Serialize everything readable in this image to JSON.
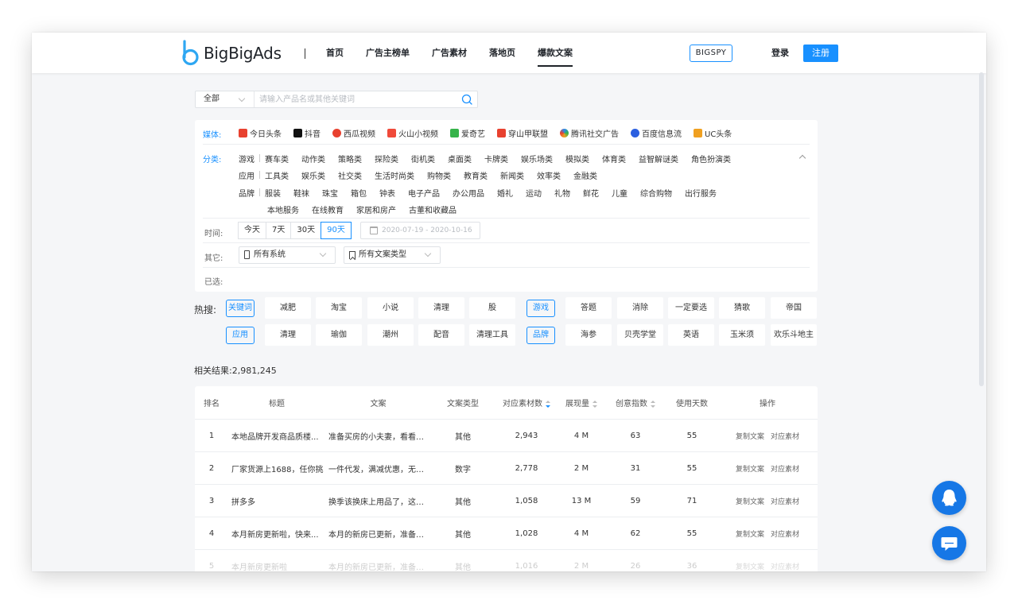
{
  "header": {
    "logo_text": "BigBigAds",
    "nav": [
      "首页",
      "广告主榜单",
      "广告素材",
      "落地页",
      "爆款文案"
    ],
    "active_nav": "爆款文案",
    "bigspy": "BIGSPY",
    "login": "登录",
    "register": "注册"
  },
  "search": {
    "select_value": "全部",
    "placeholder": "请输入产品名或其他关键词"
  },
  "filters": {
    "media_label": "媒体:",
    "media": [
      {
        "name": "今日头条",
        "icon": "toutiao-icon",
        "color": "#e8412f"
      },
      {
        "name": "抖音",
        "icon": "douyin-icon",
        "color": "#111111"
      },
      {
        "name": "西瓜视频",
        "icon": "xigua-icon",
        "color": "#e8412f"
      },
      {
        "name": "火山小视频",
        "icon": "huoshan-icon",
        "color": "#f04a3a"
      },
      {
        "name": "爱奇艺",
        "icon": "iqiyi-icon",
        "color": "#36b34a"
      },
      {
        "name": "穿山甲联盟",
        "icon": "pangle-icon",
        "color": "#e8412f"
      },
      {
        "name": "腾讯社交广告",
        "icon": "tencent-icon",
        "color": "#2b88f0"
      },
      {
        "name": "百度信息流",
        "icon": "baidu-icon",
        "color": "#2b5fe0"
      },
      {
        "name": "UC头条",
        "icon": "uc-icon",
        "color": "#f0a020"
      }
    ],
    "category_label": "分类:",
    "categories": {
      "game_head": "游戏",
      "game": [
        "赛车类",
        "动作类",
        "策略类",
        "探险类",
        "街机类",
        "桌面类",
        "卡牌类",
        "娱乐场类",
        "模拟类",
        "体育类",
        "益智解谜类",
        "角色扮演类"
      ],
      "app_head": "应用",
      "app": [
        "工具类",
        "娱乐类",
        "社交类",
        "生活时尚类",
        "购物类",
        "教育类",
        "新闻类",
        "效率类",
        "金融类"
      ],
      "brand_head": "品牌",
      "brand": [
        "服装",
        "鞋袜",
        "珠宝",
        "箱包",
        "钟表",
        "电子产品",
        "办公用品",
        "婚礼",
        "运动",
        "礼物",
        "鲜花",
        "儿童",
        "综合购物",
        "出行服务"
      ],
      "brand2": [
        "本地服务",
        "在线教育",
        "家居和房产",
        "古董和收藏品"
      ]
    },
    "time_label": "时间:",
    "time_options": [
      "今天",
      "7天",
      "30天",
      "90天"
    ],
    "time_selected": "90天",
    "date_range": "2020-07-19 - 2020-10-16",
    "other_label": "其它:",
    "system_select": "所有系统",
    "copy_type_select": "所有文案类型",
    "selected_label": "已选:"
  },
  "hot": {
    "label": "热搜:",
    "row1_tag": "关键词",
    "row1a": [
      "减肥",
      "淘宝",
      "小说",
      "清理",
      "股"
    ],
    "row1_tag2": "游戏",
    "row1b": [
      "答题",
      "消除",
      "一定要选",
      "猜歌",
      "帝国"
    ],
    "row2_tag": "应用",
    "row2a": [
      "清理",
      "瑜伽",
      "潮州",
      "配音",
      "清理工具"
    ],
    "row2_tag2": "品牌",
    "row2b": [
      "海参",
      "贝壳学堂",
      "英语",
      "玉米须",
      "欢乐斗地主"
    ]
  },
  "results": {
    "count_text": "相关结果:2,981,245"
  },
  "table": {
    "headers": [
      "排名",
      "标题",
      "文案",
      "文案类型",
      "对应素材数",
      "展现量",
      "创意指数",
      "使用天数",
      "操作"
    ],
    "rows": [
      {
        "rank": "1",
        "title": "本地品牌开发商品质楼...",
        "copy": "准备买房的小夫妻，看看这...",
        "type": "其他",
        "materials": "2,943",
        "impressions": "4 M",
        "index": "63",
        "days": "55"
      },
      {
        "rank": "2",
        "title": "厂家货源上1688，任你挑",
        "copy": "一件代发，满减优惠，无需...",
        "type": "数字",
        "materials": "2,778",
        "impressions": "2 M",
        "index": "31",
        "days": "55"
      },
      {
        "rank": "3",
        "title": "拼多多",
        "copy": "换季该换床上用品了，这里...",
        "type": "其他",
        "materials": "1,058",
        "impressions": "13 M",
        "index": "59",
        "days": "71"
      },
      {
        "rank": "4",
        "title": "本月新房更新啦，快来...",
        "copy": "本月的新房已更新，准备买...",
        "type": "其他",
        "materials": "1,028",
        "impressions": "4 M",
        "index": "62",
        "days": "55"
      },
      {
        "rank": "5",
        "title": "本月新房更新啦",
        "copy": "本月的新房已更新，准备买...",
        "type": "其他",
        "materials": "1,016",
        "impressions": "2 M",
        "index": "26",
        "days": "36"
      }
    ],
    "op_copy": "复制文案",
    "op_material": "对应素材"
  }
}
